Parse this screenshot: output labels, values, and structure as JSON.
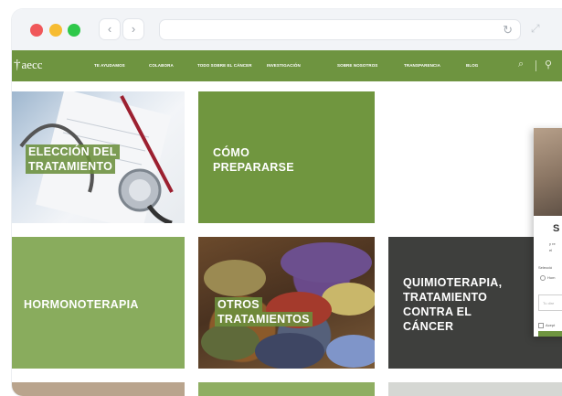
{
  "browser": {
    "back_icon": "‹",
    "forward_icon": "›",
    "reload_icon": "↻",
    "expand_icon": "⤢"
  },
  "header": {
    "logo_cross": "†",
    "logo_text": "aecc",
    "nav": [
      "TE AYUDAMOS",
      "COLABORA",
      "TODO SOBRE EL CÁNCER",
      "INVESTIGACIÓN",
      "SOBRE NOSOTROS",
      "TRANSPARENCIA",
      "BLOG"
    ],
    "search_icon": "⌕",
    "user_icon": "⚲"
  },
  "tiles": {
    "eleccion": [
      "ELECCIÓN DEL",
      "TRATAMIENTO"
    ],
    "como": [
      "CÓMO",
      "PREPARARSE"
    ],
    "hormono": "HORMONOTERAPIA",
    "otros": [
      "OTROS",
      "TRATAMIENTOS"
    ],
    "quimio": [
      "QUIMIOTERAPIA,",
      "TRATAMIENTO",
      "CONTRA EL",
      "CÁNCER"
    ]
  },
  "popup": {
    "letter": "S",
    "line1": "y re",
    "line2": "el",
    "select_label": "Selecció",
    "radio_label": "Hom",
    "input_placeholder": "Tu dire",
    "accept_label": "Acept"
  },
  "colors": {
    "brand_green": "#6e9440",
    "tile_green_dark": "#70963f",
    "tile_green_light": "#89ac5d",
    "tile_dark": "#3e3f3d"
  }
}
